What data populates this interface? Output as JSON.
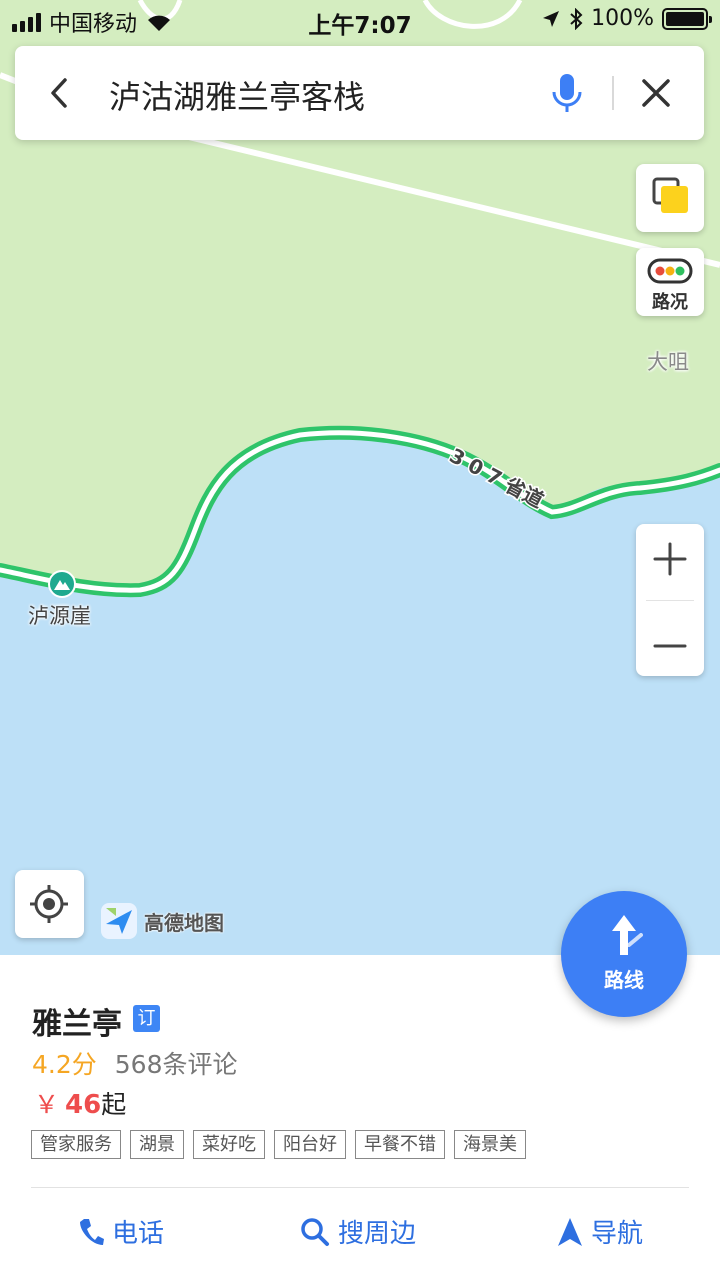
{
  "status_bar": {
    "carrier": "中国移动",
    "time": "上午7:07",
    "battery": "100%"
  },
  "search": {
    "query": "泸沽湖雅兰亭客栈"
  },
  "map": {
    "traffic_label": "路况",
    "place_labels": {
      "dazui": "大咀",
      "luyuanya": "泸源崖",
      "road": "3 0 7 省道"
    },
    "brand": "高德地图"
  },
  "route_button": {
    "label": "路线"
  },
  "place": {
    "name": "雅兰亭",
    "badge": "订",
    "rating": "4.2分",
    "reviews": "568条评论",
    "price_symbol": "￥",
    "price_value": "46",
    "price_suffix": "起",
    "tags": [
      "管家服务",
      "湖景",
      "菜好吃",
      "阳台好",
      "早餐不错",
      "海景美"
    ]
  },
  "actions": {
    "phone": "电话",
    "nearby": "搜周边",
    "navigate": "导航"
  },
  "colors": {
    "accent": "#3d7ff5",
    "rating": "#f5a623",
    "price": "#ee4d4d",
    "land": "#d4edc0",
    "water": "#bde0f7",
    "road": "#2fc46a"
  }
}
